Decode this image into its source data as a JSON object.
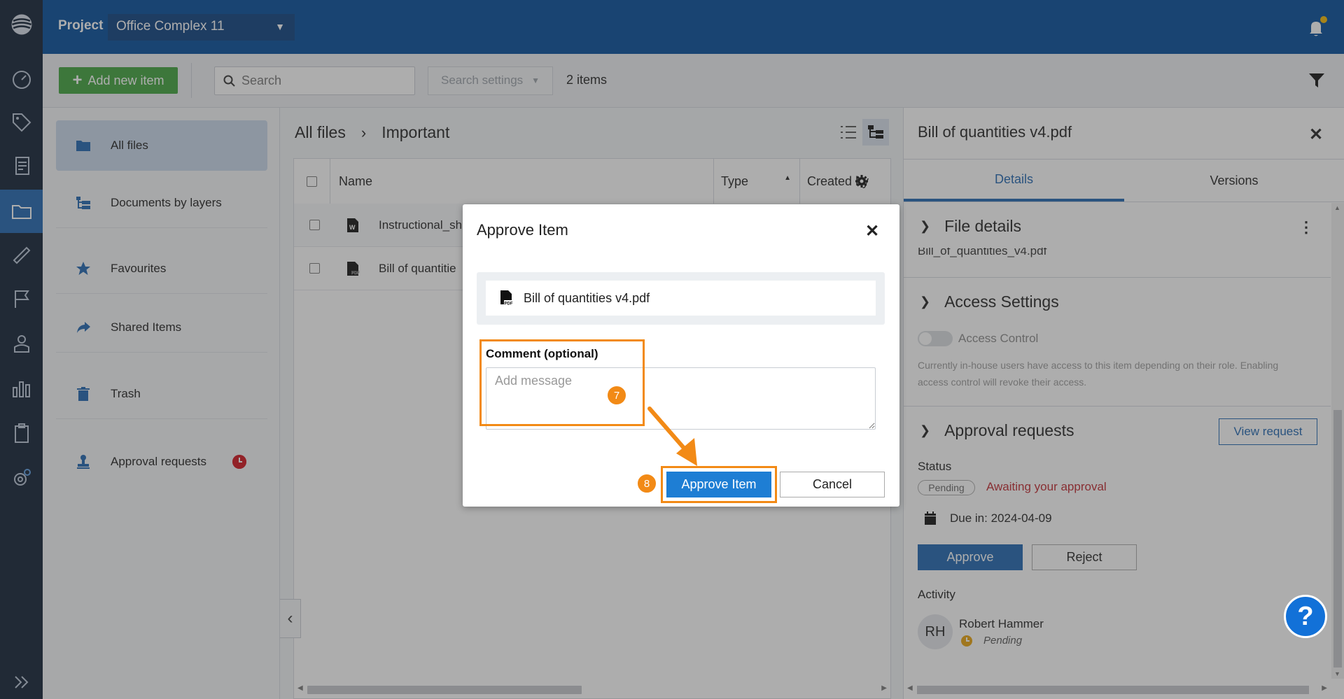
{
  "header": {
    "project_label": "Project",
    "project_value": "Office Complex 11"
  },
  "toolbar": {
    "add_label": "Add new item",
    "search_placeholder": "Search",
    "search_settings": "Search settings",
    "items_count": "2 items"
  },
  "sidebar": {
    "items": [
      {
        "label": "All files",
        "icon": "folder-icon"
      },
      {
        "label": "Documents by layers",
        "icon": "layers-icon"
      },
      {
        "label": "Favourites",
        "icon": "star-icon"
      },
      {
        "label": "Shared Items",
        "icon": "share-icon"
      },
      {
        "label": "Trash",
        "icon": "trash-icon"
      },
      {
        "label": "Approval requests",
        "icon": "stamp-icon"
      }
    ]
  },
  "breadcrumb": {
    "root": "All files",
    "current": "Important"
  },
  "table": {
    "columns": [
      "Name",
      "Type",
      "Created by"
    ],
    "rows": [
      {
        "name": "Instructional_sh",
        "icon": "word-file-icon"
      },
      {
        "name": "Bill of quantitie",
        "icon": "pdf-file-icon"
      }
    ]
  },
  "panel": {
    "title": "Bill of quantities v4.pdf",
    "tabs": [
      "Details",
      "Versions"
    ],
    "file_details": {
      "title": "File details",
      "clipped_filename": "Bill_of_quantities_v4.pdf"
    },
    "access": {
      "title": "Access Settings",
      "toggle_label": "Access Control",
      "description": "Currently in-house users have access to this item depending on their role. Enabling access control will revoke their access."
    },
    "approval": {
      "title": "Approval requests",
      "view_request": "View request",
      "status_label": "Status",
      "status_pill": "Pending",
      "status_text": "Awaiting your approval",
      "due": "Due in: 2024-04-09",
      "approve": "Approve",
      "reject": "Reject"
    },
    "activity": {
      "title": "Activity",
      "initials": "RH",
      "user": "Robert Hammer",
      "state": "Pending"
    }
  },
  "modal": {
    "title": "Approve Item",
    "file_name": "Bill of quantities v4.pdf",
    "comment_label": "Comment (optional)",
    "comment_placeholder": "Add message",
    "approve_label": "Approve Item",
    "cancel_label": "Cancel",
    "step_comment": "7",
    "step_approve": "8"
  },
  "help": {
    "label": "?"
  },
  "colors": {
    "header_bg": "#004b9a",
    "rail_bg": "#0f1e33",
    "primary": "#1e65b0",
    "add_green": "#3fa33b",
    "highlight_orange": "#f28a16",
    "alert_red": "#c0262d"
  }
}
